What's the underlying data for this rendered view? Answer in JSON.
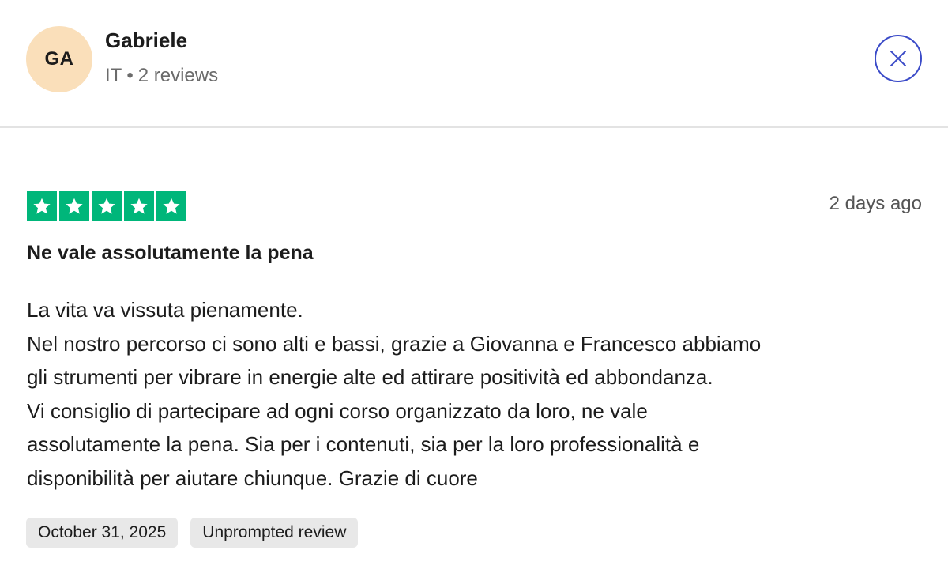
{
  "reviewer": {
    "initials": "GA",
    "name": "Gabriele",
    "country": "IT",
    "separator": "•",
    "reviews_count": "2 reviews"
  },
  "close_icon": "close-icon",
  "review": {
    "rating": 5,
    "max_rating": 5,
    "star_color": "#00b67a",
    "relative_date": "2 days ago",
    "title": "Ne vale assolutamente la pena",
    "body_lines": [
      "La vita va vissuta pienamente.",
      "Nel nostro percorso ci sono alti e bassi, grazie a Giovanna e Francesco abbiamo",
      "gli strumenti per vibrare in energie alte ed attirare positività ed abbondanza.",
      "Vi consiglio di partecipare ad ogni corso organizzato da loro, ne vale",
      "assolutamente la pena. Sia per i contenuti, sia per la loro professionalità e",
      "disponibilità per aiutare chiunque. Grazie di cuore"
    ],
    "date_tag": "October 31, 2025",
    "type_tag": "Unprompted review"
  },
  "colors": {
    "avatar_bg": "#fadfba",
    "close_accent": "#3b4bc8",
    "tag_bg": "#e8e8e8"
  }
}
